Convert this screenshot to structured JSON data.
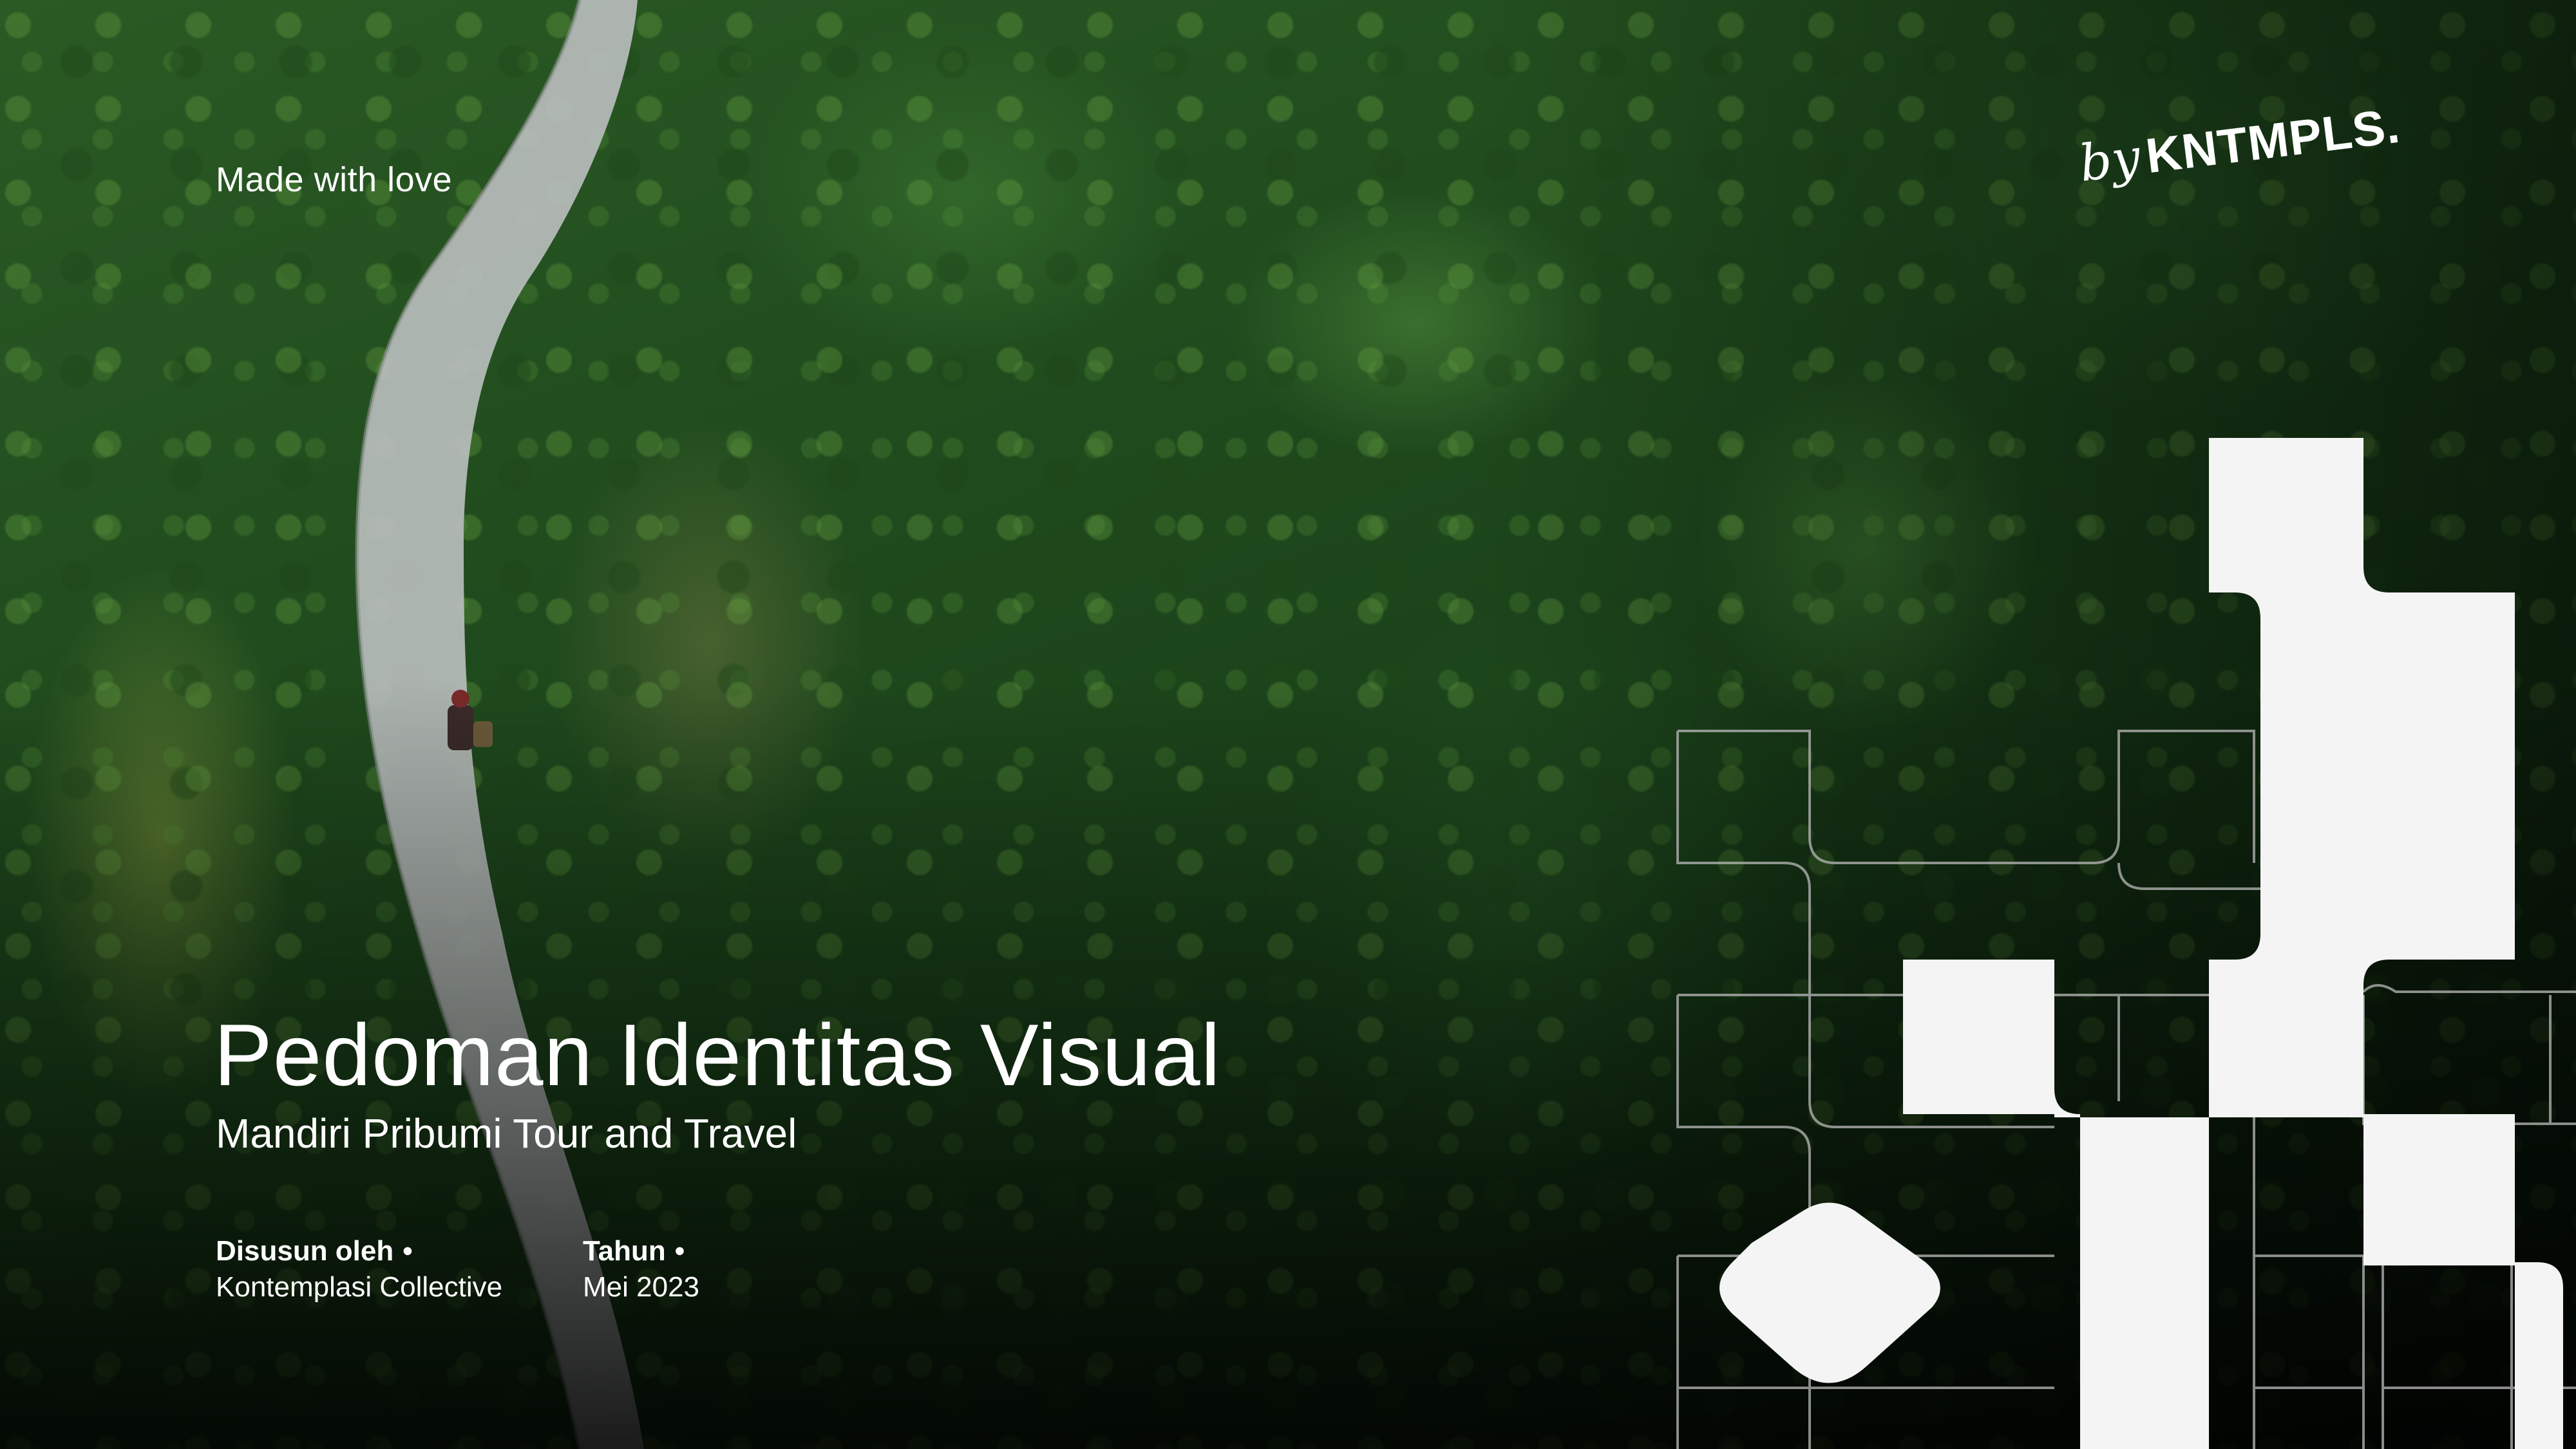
{
  "header": {
    "tagline": "Made with love",
    "by_prefix": "by",
    "brand": "KNTMPLS."
  },
  "cover": {
    "title": "Pedoman Identitas Visual",
    "subtitle": "Mandiri Pribumi Tour and Travel"
  },
  "meta": {
    "author_label": "Disusun oleh",
    "author_value": "Kontemplasi Collective",
    "year_label": "Tahun",
    "year_value": "Mei 2023",
    "separator": "•"
  },
  "colors": {
    "text": "#ffffff",
    "shape_fill": "#f4f4f4",
    "grid_line": "#b8b8b8"
  }
}
